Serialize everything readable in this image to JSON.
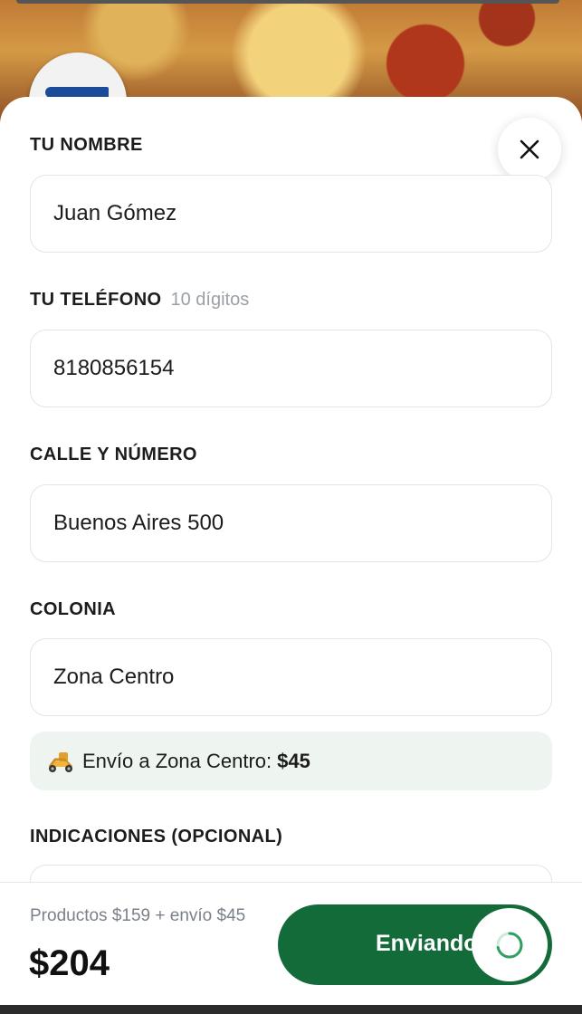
{
  "form": {
    "name": {
      "label": "TU NOMBRE",
      "value": "Juan Gómez"
    },
    "phone": {
      "label": "TU TELÉFONO",
      "hint": "10 dígitos",
      "value": "8180856154"
    },
    "street": {
      "label": "CALLE Y NÚMERO",
      "value": "Buenos Aires 500"
    },
    "colony": {
      "label": "COLONIA",
      "value": "Zona Centro"
    },
    "shipping": {
      "icon": "scooter-icon",
      "text": "Envío a Zona Centro:",
      "amount": "$45"
    },
    "directions": {
      "label": "INDICACIONES (OPCIONAL)",
      "value": ""
    }
  },
  "footer": {
    "summary": "Productos $159 + envío $45",
    "total": "$204",
    "submit_label": "Enviando"
  },
  "colors": {
    "primary": "#146b3a",
    "shipping_bg": "#eef5f0",
    "hint": "#9aa0a6"
  }
}
